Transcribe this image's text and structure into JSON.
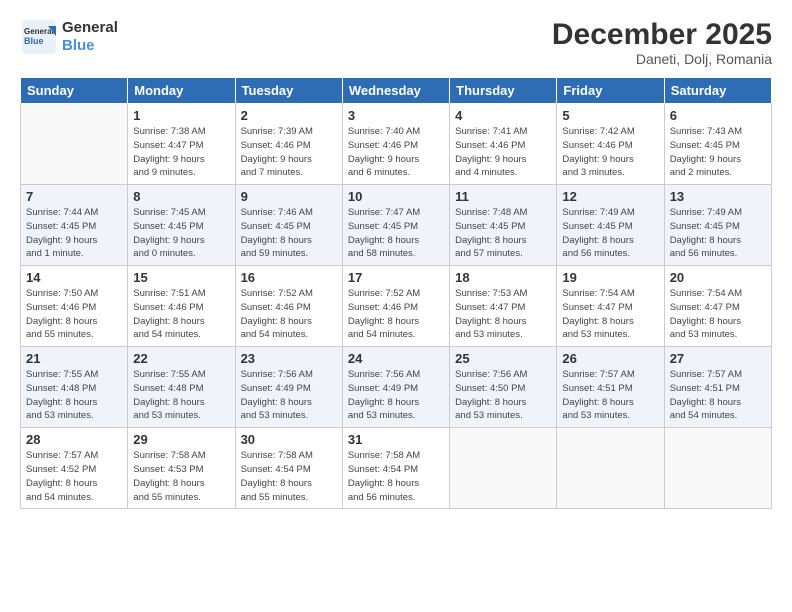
{
  "logo": {
    "line1": "General",
    "line2": "Blue"
  },
  "title": "December 2025",
  "subtitle": "Daneti, Dolj, Romania",
  "weekdays": [
    "Sunday",
    "Monday",
    "Tuesday",
    "Wednesday",
    "Thursday",
    "Friday",
    "Saturday"
  ],
  "weeks": [
    [
      {
        "day": "",
        "info": ""
      },
      {
        "day": "1",
        "info": "Sunrise: 7:38 AM\nSunset: 4:47 PM\nDaylight: 9 hours\nand 9 minutes."
      },
      {
        "day": "2",
        "info": "Sunrise: 7:39 AM\nSunset: 4:46 PM\nDaylight: 9 hours\nand 7 minutes."
      },
      {
        "day": "3",
        "info": "Sunrise: 7:40 AM\nSunset: 4:46 PM\nDaylight: 9 hours\nand 6 minutes."
      },
      {
        "day": "4",
        "info": "Sunrise: 7:41 AM\nSunset: 4:46 PM\nDaylight: 9 hours\nand 4 minutes."
      },
      {
        "day": "5",
        "info": "Sunrise: 7:42 AM\nSunset: 4:46 PM\nDaylight: 9 hours\nand 3 minutes."
      },
      {
        "day": "6",
        "info": "Sunrise: 7:43 AM\nSunset: 4:45 PM\nDaylight: 9 hours\nand 2 minutes."
      }
    ],
    [
      {
        "day": "7",
        "info": "Sunrise: 7:44 AM\nSunset: 4:45 PM\nDaylight: 9 hours\nand 1 minute."
      },
      {
        "day": "8",
        "info": "Sunrise: 7:45 AM\nSunset: 4:45 PM\nDaylight: 9 hours\nand 0 minutes."
      },
      {
        "day": "9",
        "info": "Sunrise: 7:46 AM\nSunset: 4:45 PM\nDaylight: 8 hours\nand 59 minutes."
      },
      {
        "day": "10",
        "info": "Sunrise: 7:47 AM\nSunset: 4:45 PM\nDaylight: 8 hours\nand 58 minutes."
      },
      {
        "day": "11",
        "info": "Sunrise: 7:48 AM\nSunset: 4:45 PM\nDaylight: 8 hours\nand 57 minutes."
      },
      {
        "day": "12",
        "info": "Sunrise: 7:49 AM\nSunset: 4:45 PM\nDaylight: 8 hours\nand 56 minutes."
      },
      {
        "day": "13",
        "info": "Sunrise: 7:49 AM\nSunset: 4:45 PM\nDaylight: 8 hours\nand 56 minutes."
      }
    ],
    [
      {
        "day": "14",
        "info": "Sunrise: 7:50 AM\nSunset: 4:46 PM\nDaylight: 8 hours\nand 55 minutes."
      },
      {
        "day": "15",
        "info": "Sunrise: 7:51 AM\nSunset: 4:46 PM\nDaylight: 8 hours\nand 54 minutes."
      },
      {
        "day": "16",
        "info": "Sunrise: 7:52 AM\nSunset: 4:46 PM\nDaylight: 8 hours\nand 54 minutes."
      },
      {
        "day": "17",
        "info": "Sunrise: 7:52 AM\nSunset: 4:46 PM\nDaylight: 8 hours\nand 54 minutes."
      },
      {
        "day": "18",
        "info": "Sunrise: 7:53 AM\nSunset: 4:47 PM\nDaylight: 8 hours\nand 53 minutes."
      },
      {
        "day": "19",
        "info": "Sunrise: 7:54 AM\nSunset: 4:47 PM\nDaylight: 8 hours\nand 53 minutes."
      },
      {
        "day": "20",
        "info": "Sunrise: 7:54 AM\nSunset: 4:47 PM\nDaylight: 8 hours\nand 53 minutes."
      }
    ],
    [
      {
        "day": "21",
        "info": "Sunrise: 7:55 AM\nSunset: 4:48 PM\nDaylight: 8 hours\nand 53 minutes."
      },
      {
        "day": "22",
        "info": "Sunrise: 7:55 AM\nSunset: 4:48 PM\nDaylight: 8 hours\nand 53 minutes."
      },
      {
        "day": "23",
        "info": "Sunrise: 7:56 AM\nSunset: 4:49 PM\nDaylight: 8 hours\nand 53 minutes."
      },
      {
        "day": "24",
        "info": "Sunrise: 7:56 AM\nSunset: 4:49 PM\nDaylight: 8 hours\nand 53 minutes."
      },
      {
        "day": "25",
        "info": "Sunrise: 7:56 AM\nSunset: 4:50 PM\nDaylight: 8 hours\nand 53 minutes."
      },
      {
        "day": "26",
        "info": "Sunrise: 7:57 AM\nSunset: 4:51 PM\nDaylight: 8 hours\nand 53 minutes."
      },
      {
        "day": "27",
        "info": "Sunrise: 7:57 AM\nSunset: 4:51 PM\nDaylight: 8 hours\nand 54 minutes."
      }
    ],
    [
      {
        "day": "28",
        "info": "Sunrise: 7:57 AM\nSunset: 4:52 PM\nDaylight: 8 hours\nand 54 minutes."
      },
      {
        "day": "29",
        "info": "Sunrise: 7:58 AM\nSunset: 4:53 PM\nDaylight: 8 hours\nand 55 minutes."
      },
      {
        "day": "30",
        "info": "Sunrise: 7:58 AM\nSunset: 4:54 PM\nDaylight: 8 hours\nand 55 minutes."
      },
      {
        "day": "31",
        "info": "Sunrise: 7:58 AM\nSunset: 4:54 PM\nDaylight: 8 hours\nand 56 minutes."
      },
      {
        "day": "",
        "info": ""
      },
      {
        "day": "",
        "info": ""
      },
      {
        "day": "",
        "info": ""
      }
    ]
  ]
}
